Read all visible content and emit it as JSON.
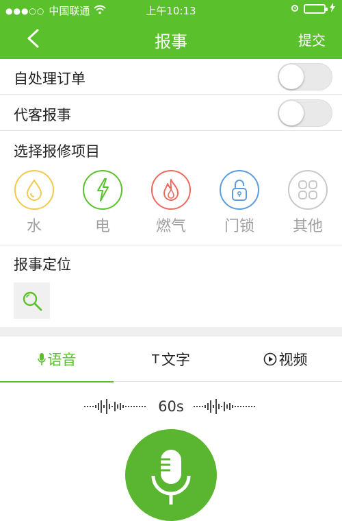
{
  "status_bar": {
    "signal": "●●●○○",
    "carrier": "中国联通",
    "time": "上午10:13",
    "battery_level": 0.0
  },
  "nav": {
    "title": "报事",
    "submit_label": "提交"
  },
  "options": {
    "self_process_label": "自处理订单",
    "self_process_on": false,
    "proxy_report_label": "代客报事",
    "proxy_report_on": false
  },
  "repair_section": {
    "label": "选择报修项目",
    "items": [
      {
        "name": "水",
        "icon": "water-drop-icon",
        "color": "#f2c94c"
      },
      {
        "name": "电",
        "icon": "lightning-icon",
        "color": "#5ac12c"
      },
      {
        "name": "燃气",
        "icon": "flame-icon",
        "color": "#ea6a5f"
      },
      {
        "name": "门锁",
        "icon": "padlock-icon",
        "color": "#5b9be0"
      },
      {
        "name": "其他",
        "icon": "grid-icon",
        "color": "#c8c8c8"
      }
    ]
  },
  "location": {
    "label": "报事定位"
  },
  "tabs": [
    {
      "label": "语音",
      "icon": "mic-icon",
      "active": true
    },
    {
      "label": "文字",
      "icon": "T",
      "active": false
    },
    {
      "label": "视频",
      "icon": "play-icon",
      "active": false
    }
  ],
  "recorder": {
    "duration": "60s"
  },
  "colors": {
    "brand_green": "#5ac12c"
  }
}
